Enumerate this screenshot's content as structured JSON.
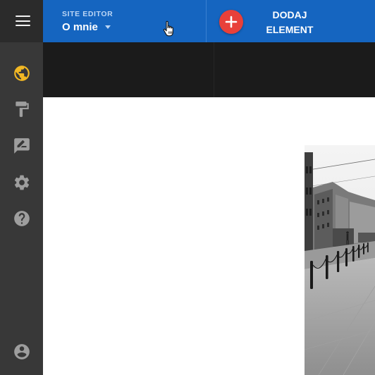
{
  "topbar": {
    "site_editor_label": "SITE EDITOR",
    "current_page": "O mnie",
    "add_element_line1": "DODAJ",
    "add_element_line2": "ELEMENT"
  },
  "sidebar": {
    "icons": [
      "globe-icon",
      "paint-roller-icon",
      "edit-note-icon",
      "gear-icon",
      "help-icon",
      "account-icon"
    ],
    "active_icon": "globe-icon"
  },
  "colors": {
    "topbar": "#1565c0",
    "rail": "#383838",
    "rail_top": "#2b2b2b",
    "dark_band": "#1b1b1b",
    "add_button": "#e8403a",
    "active_icon": "#f2b824",
    "rail_icon": "#9e9e9e"
  }
}
